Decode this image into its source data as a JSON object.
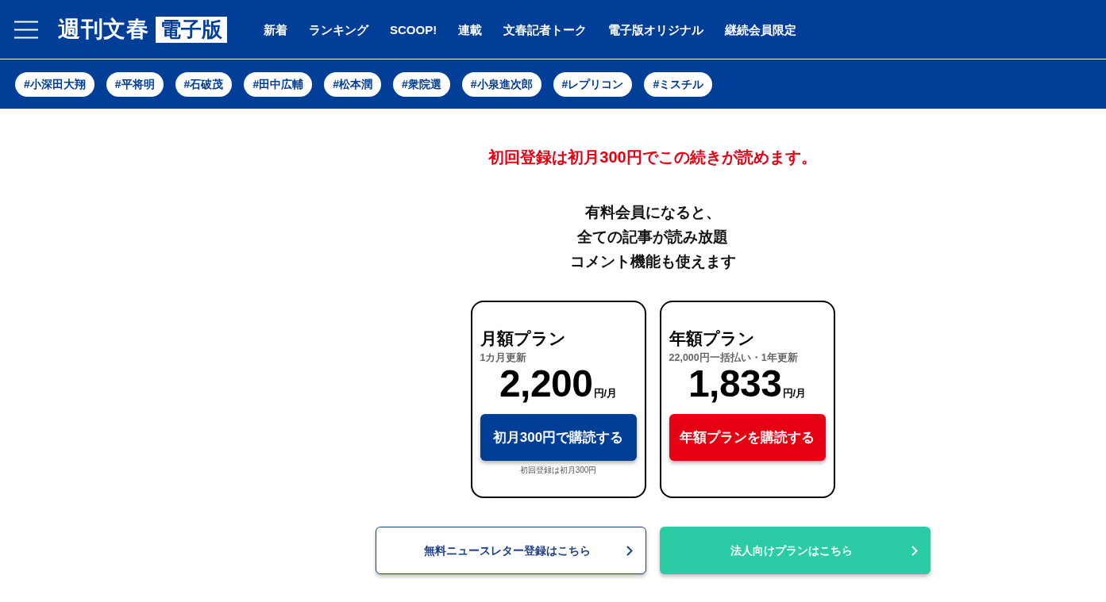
{
  "header": {
    "logo": {
      "title": "週刊文春",
      "badge": "電子版"
    },
    "nav": [
      "新着",
      "ランキング",
      "SCOOP!",
      "連載",
      "文春記者トーク",
      "電子版オリジナル",
      "継続会員限定"
    ]
  },
  "tags": [
    "#小深田大翔",
    "#平将明",
    "#石破茂",
    "#田中広輔",
    "#松本潤",
    "#衆院選",
    "#小泉進次郎",
    "#レプリコン",
    "#ミスチル"
  ],
  "paywall": {
    "headline": "初回登録は初月300円でこの続きが読めます。",
    "benefits": [
      "有料会員になると、",
      "全ての記事が読み放題",
      "コメント機能も使えます"
    ]
  },
  "plans": [
    {
      "kind": "monthly",
      "name": "月額プラン",
      "billing": "1カ月更新",
      "price": "2,200",
      "unit": "円/月",
      "button": "初月300円で購読する",
      "note": "初回登録は初月300円"
    },
    {
      "kind": "yearly",
      "name": "年額プラン",
      "billing": "22,000円一括払い・1年更新",
      "price": "1,833",
      "unit": "円/月",
      "button": "年額プランを購読する"
    }
  ],
  "links": [
    {
      "kind": "outline",
      "label": "無料ニュースレター登録はこちら"
    },
    {
      "kind": "filled",
      "label": "法人向けプランはこちら"
    }
  ]
}
